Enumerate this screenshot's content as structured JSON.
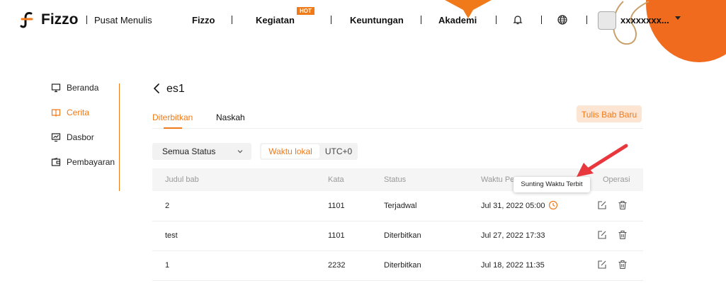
{
  "colors": {
    "accent": "#f07a1a",
    "accent_soft": "#fde5d4",
    "annotation_red": "#e8383d"
  },
  "header": {
    "brand": "Fizzo",
    "brand_sub": "Pusat Menulis",
    "nav": [
      {
        "label": "Fizzo"
      },
      {
        "label": "Kegiatan",
        "badge": "HOT"
      },
      {
        "label": "Keuntungan"
      },
      {
        "label": "Akademi"
      }
    ],
    "icons": [
      "bell-icon",
      "globe-icon"
    ],
    "username": "xxxxxxxx..."
  },
  "sidebar": {
    "items": [
      {
        "label": "Beranda",
        "icon": "monitor-icon"
      },
      {
        "label": "Cerita",
        "icon": "book-icon",
        "active": true
      },
      {
        "label": "Dasbor",
        "icon": "chart-icon"
      },
      {
        "label": "Pembayaran",
        "icon": "wallet-icon"
      }
    ]
  },
  "story": {
    "title": "es1"
  },
  "tabs": [
    {
      "label": "Diterbitkan",
      "active": true
    },
    {
      "label": "Naskah"
    }
  ],
  "new_chapter_label": "Tulis Bab Baru",
  "filter": {
    "status_value": "Semua Status"
  },
  "timezone": {
    "local": "Waktu lokal",
    "utc": "UTC+0",
    "selected": "Waktu lokal"
  },
  "table": {
    "headers": {
      "title": "Judul bab",
      "words": "Kata",
      "status": "Status",
      "time": "Waktu Pe",
      "ops": "Operasi"
    },
    "rows": [
      {
        "title": "2",
        "words": "1101",
        "status": "Terjadwal",
        "time": "Jul 31, 2022 05:00",
        "scheduled": true
      },
      {
        "title": "test",
        "words": "1101",
        "status": "Diterbitkan",
        "time": "Jul 27, 2022 17:33"
      },
      {
        "title": "1",
        "words": "2232",
        "status": "Diterbitkan",
        "time": "Jul 18, 2022 11:35"
      }
    ]
  },
  "tooltip": "Sunting Waktu Terbit"
}
